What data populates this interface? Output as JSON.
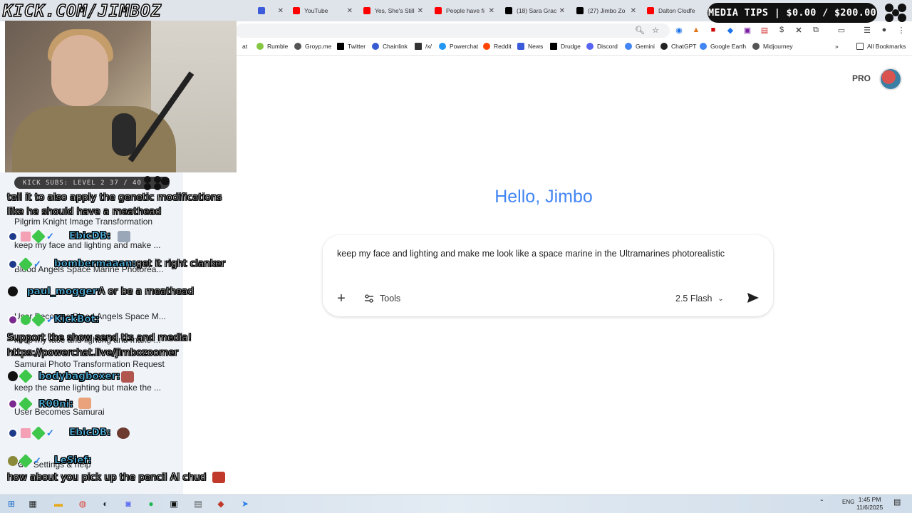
{
  "browser": {
    "tabs": [
      {
        "label": "YouTube",
        "color": "#ff0000"
      },
      {
        "label": "Yes, She's Still",
        "color": "#ff0000"
      },
      {
        "label": "People have fi",
        "color": "#ff0000"
      },
      {
        "label": "(18) Sara Grac",
        "color": "#000000"
      },
      {
        "label": "(27) Jimbo Zo",
        "color": "#000000"
      },
      {
        "label": "Dalton Clodfe",
        "color": "#ff0000"
      }
    ],
    "bookmarks": [
      {
        "label": "at",
        "color": "#ffffff"
      },
      {
        "label": "Rumble",
        "color": "#85c742"
      },
      {
        "label": "Groyp.me",
        "color": "#555555"
      },
      {
        "label": "Twitter",
        "color": "#000000"
      },
      {
        "label": "Chainlink",
        "color": "#375bd2"
      },
      {
        "label": "/x/",
        "color": "#333333"
      },
      {
        "label": "Powerchat",
        "color": "#2196f3"
      },
      {
        "label": "Reddit",
        "color": "#ff4500"
      },
      {
        "label": "News",
        "color": "#3b5bdb"
      },
      {
        "label": "Drudge",
        "color": "#000000"
      },
      {
        "label": "Discord",
        "color": "#5865f2"
      },
      {
        "label": "Gemini",
        "color": "#4285f4"
      },
      {
        "label": "ChatGPT",
        "color": "#222222"
      },
      {
        "label": "Google Earth",
        "color": "#4285f4"
      },
      {
        "label": "Midjourney",
        "color": "#555555"
      }
    ],
    "all_bookmarks": "All Bookmarks"
  },
  "overlay": {
    "url_text": "KICK.COM/JIMBOZ",
    "media_tips": "MEDIA TIPS | $0.00 / $200.00",
    "kick_subs": "KICK SUBS: LEVEL 2 37 / 40"
  },
  "sidebar": {
    "items": [
      "Pilgrim Knight Image Transformation",
      "keep my face and lighting and make ...",
      "Blood Angels Space Marine Photorea...",
      "User Becomes Blood Angels Space M...",
      "keep my face and lighting and make ...",
      "Samurai Photo Transformation Request",
      "keep the same lighting but make the ...",
      "User Becomes Samurai"
    ],
    "settings_label": "Settings & help"
  },
  "chat": {
    "messages": [
      {
        "user": "",
        "text": "tell it to also apply the genetic modifications like he should have a meathead"
      },
      {
        "user": "EbicDB:",
        "text": ""
      },
      {
        "user": "bombermaaan:",
        "text": "get it right clanker"
      },
      {
        "user": "paul_mogger:",
        "text": "A or be a meathead"
      },
      {
        "user": "KickBot:",
        "text": ""
      },
      {
        "user": "",
        "text": "Support the show send tts and media! https://powerchat.live/jimbozoomer"
      },
      {
        "user": "bodybagboxer:",
        "text": ""
      },
      {
        "user": "R00ni:",
        "text": ""
      },
      {
        "user": "EbicDB:",
        "text": ""
      },
      {
        "user": "LeSief:",
        "text": "how about you pick up the pencil AI chud"
      }
    ]
  },
  "main": {
    "plan_label": "PRO",
    "greeting": "Hello, Jimbo",
    "prompt": "keep my face and lighting and make me look like a space marine in the Ultramarines photorealistic",
    "tools_label": "Tools",
    "model_label": "2.5 Flash"
  },
  "taskbar": {
    "lang": "ENG",
    "time": "1:45 PM",
    "date": "11/6/2025"
  }
}
